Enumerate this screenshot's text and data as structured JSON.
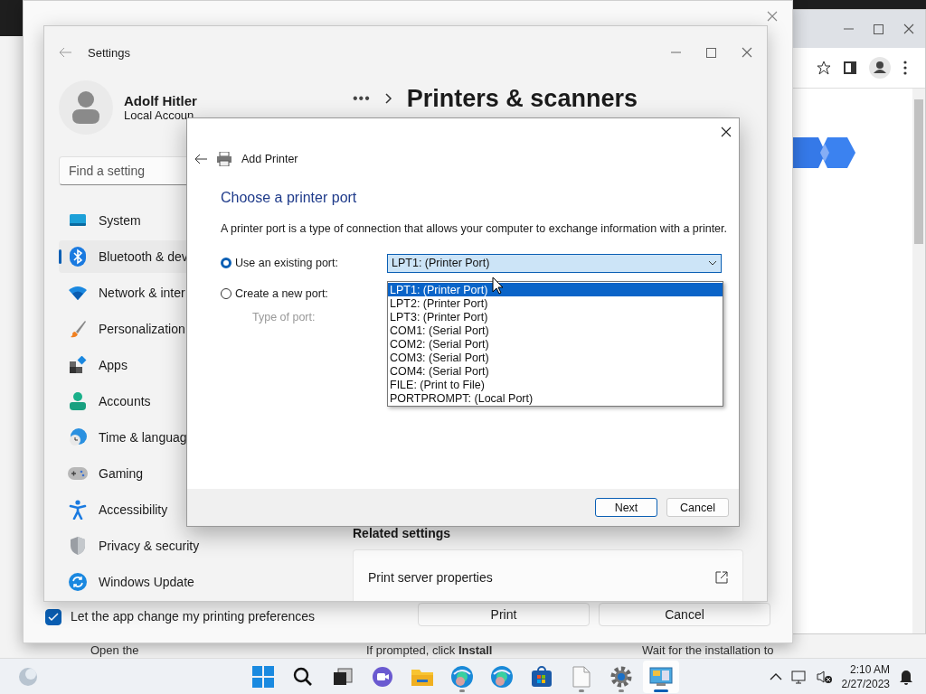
{
  "background_page": {
    "texts": [
      "Open the",
      "If prompted, click **Install**",
      "Wait for the installation to"
    ]
  },
  "print_dialog": {
    "checkbox": {
      "label": "Let the app change my printing preferences",
      "checked": true
    },
    "buttons": [
      "Print",
      "Cancel"
    ]
  },
  "settings": {
    "title": "Settings",
    "user": {
      "name": "Adolf Hitler",
      "account": "Local Accoun"
    },
    "search": {
      "placeholder": "Find a setting"
    },
    "nav": [
      {
        "label": "System",
        "selected": false
      },
      {
        "label": "Bluetooth & dev",
        "selected": true
      },
      {
        "label": "Network & inter",
        "selected": false
      },
      {
        "label": "Personalization",
        "selected": false
      },
      {
        "label": "Apps",
        "selected": false
      },
      {
        "label": "Accounts",
        "selected": false
      },
      {
        "label": "Time & languag",
        "selected": false
      },
      {
        "label": "Gaming",
        "selected": false
      },
      {
        "label": "Accessibility",
        "selected": false
      },
      {
        "label": "Privacy & security",
        "selected": false
      },
      {
        "label": "Windows Update",
        "selected": false
      }
    ],
    "breadcrumb_more": "•••",
    "page_title": "Printers & scanners",
    "related_heading": "Related settings",
    "related_items": [
      "Print server properties"
    ]
  },
  "dialog": {
    "title": "Add Printer",
    "heading": "Choose a printer port",
    "description": "A printer port is a type of connection that allows your computer to exchange information with a printer.",
    "options": [
      {
        "label": "Use an existing port:",
        "selected": true
      },
      {
        "label": "Create a new port:",
        "selected": false
      }
    ],
    "type_of_port": {
      "label": "Type of port:",
      "disabled": true
    },
    "combo_value": "LPT1: (Printer Port)",
    "ports": [
      {
        "label": "LPT1: (Printer Port)",
        "selected": true
      },
      {
        "label": "LPT2: (Printer Port)",
        "selected": false
      },
      {
        "label": "LPT3: (Printer Port)",
        "selected": false
      },
      {
        "label": "COM1: (Serial Port)",
        "selected": false
      },
      {
        "label": "COM2: (Serial Port)",
        "selected": false
      },
      {
        "label": "COM3: (Serial Port)",
        "selected": false
      },
      {
        "label": "COM4: (Serial Port)",
        "selected": false
      },
      {
        "label": "FILE: (Print to File)",
        "selected": false
      },
      {
        "label": "PORTPROMPT: (Local Port)",
        "selected": false
      }
    ],
    "buttons": [
      "Next",
      "Cancel"
    ]
  },
  "taskbar": {
    "apps": [
      {
        "kind": "start",
        "running": false,
        "active": false
      },
      {
        "kind": "search",
        "running": false,
        "active": false
      },
      {
        "kind": "taskview",
        "running": false,
        "active": false
      },
      {
        "kind": "chat",
        "running": false,
        "active": false
      },
      {
        "kind": "folder",
        "running": false,
        "active": false
      },
      {
        "kind": "browser",
        "running": true,
        "active": false
      },
      {
        "kind": "browser",
        "running": false,
        "active": false
      },
      {
        "kind": "store",
        "running": false,
        "active": false
      },
      {
        "kind": "file",
        "running": true,
        "active": false
      },
      {
        "kind": "gear",
        "running": true,
        "active": false
      },
      {
        "kind": "control",
        "running": true,
        "active": true
      }
    ],
    "time": "2:10 AM",
    "date": "2/27/2023"
  }
}
